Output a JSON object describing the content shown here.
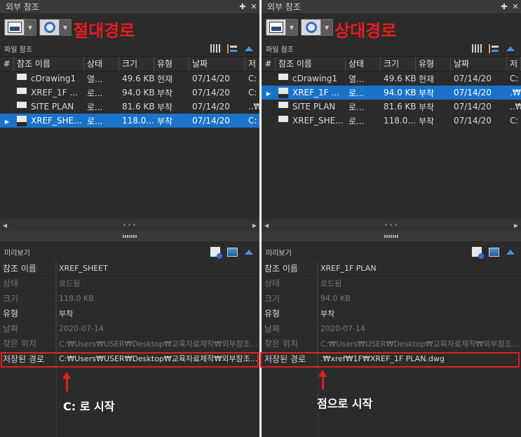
{
  "colors": {
    "accent_red": "#ee1b1b",
    "selection": "#1a73c8",
    "panel_bg": "#2b2b2b"
  },
  "panels": [
    {
      "title": "외부 참조",
      "pin_icon": "pin-icon",
      "close_icon": "close-icon",
      "big_label": "절대경로",
      "section_title": "파일 참조",
      "columns": [
        "#",
        "참조 이름",
        "상태",
        "크기",
        "유형",
        "날짜",
        "저"
      ],
      "rows": [
        {
          "name": "cDrawing1",
          "status": "열...",
          "size": "49.6 KB",
          "type": "현재",
          "date": "07/14/20",
          "path": "C:",
          "selected": false
        },
        {
          "name": "XREF_1F ...",
          "status": "로...",
          "size": "94.0 KB",
          "type": "부착",
          "date": "07/14/20",
          "path": "C:",
          "selected": false
        },
        {
          "name": "SITE PLAN",
          "status": "로...",
          "size": "81.6 KB",
          "type": "부착",
          "date": "07/14/20",
          "path": "..₩",
          "selected": false
        },
        {
          "name": "XREF_SHE...",
          "status": "로...",
          "size": "118.0...",
          "type": "부착",
          "date": "07/14/20",
          "path": "C:",
          "selected": true
        }
      ],
      "preview_title": "미리보기",
      "props": [
        {
          "key": "참조 이름",
          "value": "XREF_SHEET",
          "dim": false
        },
        {
          "key": "상태",
          "value": "로드됨",
          "dim": true
        },
        {
          "key": "크기",
          "value": "118.0 KB",
          "dim": true
        },
        {
          "key": "유형",
          "value": "부착",
          "dim": false
        },
        {
          "key": "날짜",
          "value": "2020-07-14",
          "dim": true
        },
        {
          "key": "찾은 위치",
          "value": "C:₩Users₩USER₩Desktop₩교육자료제작₩외부참조...",
          "dim": true
        },
        {
          "key": "저장된 경로",
          "value": "C:₩Users₩USER₩Desktop₩교육자료제작₩외부참조...",
          "dim": false
        }
      ],
      "annotation": "C: 로 시작"
    },
    {
      "title": "외부 참조",
      "pin_icon": "pin-icon",
      "close_icon": "close-icon",
      "big_label": "상대경로",
      "section_title": "파일 참조",
      "columns": [
        "#",
        "참조 이름",
        "상태",
        "크기",
        "유형",
        "날짜",
        "저"
      ],
      "rows": [
        {
          "name": "cDrawing1",
          "status": "열...",
          "size": "49.6 KB",
          "type": "현재",
          "date": "07/14/20",
          "path": "C:",
          "selected": false
        },
        {
          "name": "XREF_1F ...",
          "status": "로...",
          "size": "94.0 KB",
          "type": "부착",
          "date": "07/14/20",
          "path": ".₩",
          "selected": true
        },
        {
          "name": "SITE PLAN",
          "status": "로...",
          "size": "81.6 KB",
          "type": "부착",
          "date": "07/14/20",
          "path": "..₩",
          "selected": false
        },
        {
          "name": "XREF_SHE...",
          "status": "로...",
          "size": "118.0...",
          "type": "부착",
          "date": "07/14/20",
          "path": "C:",
          "selected": false
        }
      ],
      "preview_title": "미리보기",
      "props": [
        {
          "key": "참조 이름",
          "value": "XREF_1F PLAN",
          "dim": false
        },
        {
          "key": "상태",
          "value": "로드됨",
          "dim": true
        },
        {
          "key": "크기",
          "value": "94.0 KB",
          "dim": true
        },
        {
          "key": "유형",
          "value": "부착",
          "dim": false
        },
        {
          "key": "날짜",
          "value": "2020-07-14",
          "dim": true
        },
        {
          "key": "찾은 위치",
          "value": "C:₩Users₩USER₩Desktop₩교육자료제작₩외부참조...",
          "dim": true
        },
        {
          "key": "저장된 경로",
          "value": ".₩xref₩1F₩XREF_1F PLAN.dwg",
          "dim": false
        }
      ],
      "annotation": "점으로 시작"
    }
  ]
}
